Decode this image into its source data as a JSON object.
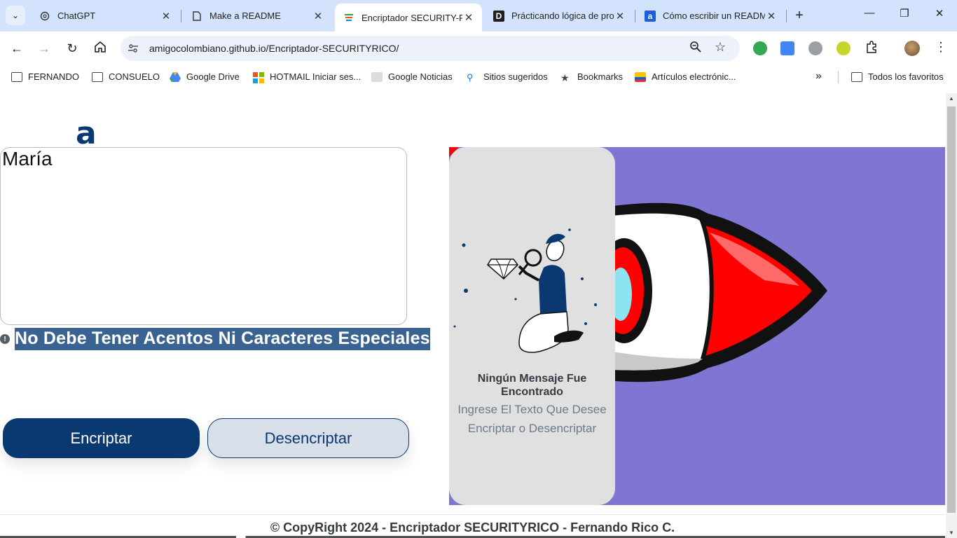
{
  "browser": {
    "tabs": [
      {
        "title": "ChatGPT",
        "icon": "chatgpt-icon"
      },
      {
        "title": "Make a README",
        "icon": "document-icon"
      },
      {
        "title": "Encriptador SECURITY-RICO",
        "icon": "github-pages-icon",
        "active": true
      },
      {
        "title": "Prácticando lógica de programación",
        "icon": "notion-icon"
      },
      {
        "title": "Cómo escribir un README",
        "icon": "alura-icon"
      }
    ],
    "url": "amigocolombiano.github.io/Encriptador-SECURITYRICO/",
    "bookmarks": [
      {
        "label": "FERNANDO",
        "icon": "folder-icon"
      },
      {
        "label": "CONSUELO",
        "icon": "folder-icon"
      },
      {
        "label": "Google Drive",
        "icon": "google-drive-icon"
      },
      {
        "label": "HOTMAIL Iniciar ses...",
        "icon": "microsoft-icon"
      },
      {
        "label": "Google Noticias",
        "icon": "news-icon"
      },
      {
        "label": "Sitios sugeridos",
        "icon": "search-icon"
      },
      {
        "label": "Bookmarks",
        "icon": "star-icon"
      },
      {
        "label": "Artículos electrónic...",
        "icon": "shop-icon"
      }
    ],
    "all_bookmarks_label": "Todos los favoritos"
  },
  "page": {
    "logo_glyph": "a",
    "input_value": "María",
    "warning_text": "No Debe Tener Acentos Ni Caracteres Especiales",
    "encrypt_label": "Encriptar",
    "decrypt_label": "Desencriptar",
    "output": {
      "title": "Ningún Mensaje Fue Encontrado",
      "subtitle": "Ingrese El Texto Que Desee Encriptar o Desencriptar"
    },
    "footer": "© CopyRight 2024 - Encriptador SECURITYRICO - Fernando Rico C."
  },
  "colors": {
    "primary": "#0a3871",
    "hero_background": "#7f76d3",
    "panel_background": "#e0e0e0",
    "warning_highlight": "#3a6391"
  }
}
